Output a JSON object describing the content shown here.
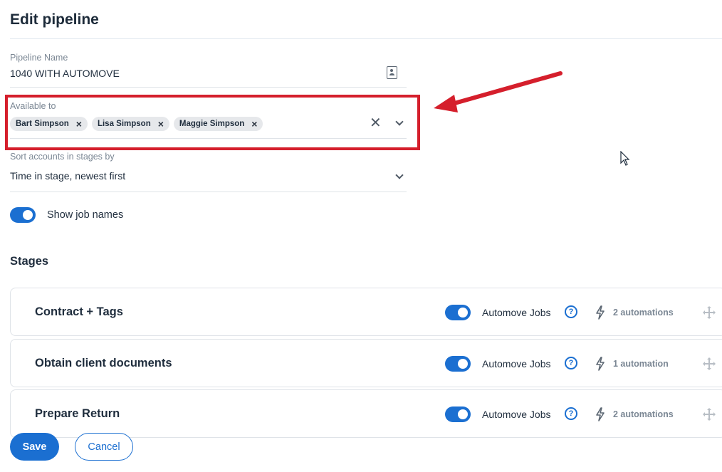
{
  "page": {
    "title": "Edit pipeline"
  },
  "pipeline_name": {
    "label": "Pipeline Name",
    "value": "1040 WITH AUTOMOVE",
    "icon": "contact-card-icon"
  },
  "available_to": {
    "label": "Available to",
    "chips": [
      {
        "label": "Bart Simpson"
      },
      {
        "label": "Lisa Simpson"
      },
      {
        "label": "Maggie Simpson"
      }
    ],
    "chip_remove_glyph": "×",
    "clear_glyph": "✕"
  },
  "sort": {
    "label": "Sort accounts in stages by",
    "value": "Time in stage, newest first"
  },
  "show_job_names": {
    "label": "Show job names",
    "enabled": true
  },
  "stages_section": {
    "title": "Stages"
  },
  "stages": [
    {
      "title": "Contract  + Tags",
      "automove_label": "Automove Jobs",
      "automove_enabled": true,
      "automations": "2 automations"
    },
    {
      "title": "Obtain client documents",
      "automove_label": "Automove Jobs",
      "automove_enabled": true,
      "automations": "1 automation"
    },
    {
      "title": "Prepare Return",
      "automove_label": "Automove Jobs",
      "automove_enabled": true,
      "automations": "2 automations"
    }
  ],
  "help_glyph": "?",
  "buttons": {
    "save": "Save",
    "cancel": "Cancel"
  },
  "colors": {
    "accent": "#1b6fd1",
    "highlight": "#d51f2c",
    "text": "#1f2d3d"
  }
}
